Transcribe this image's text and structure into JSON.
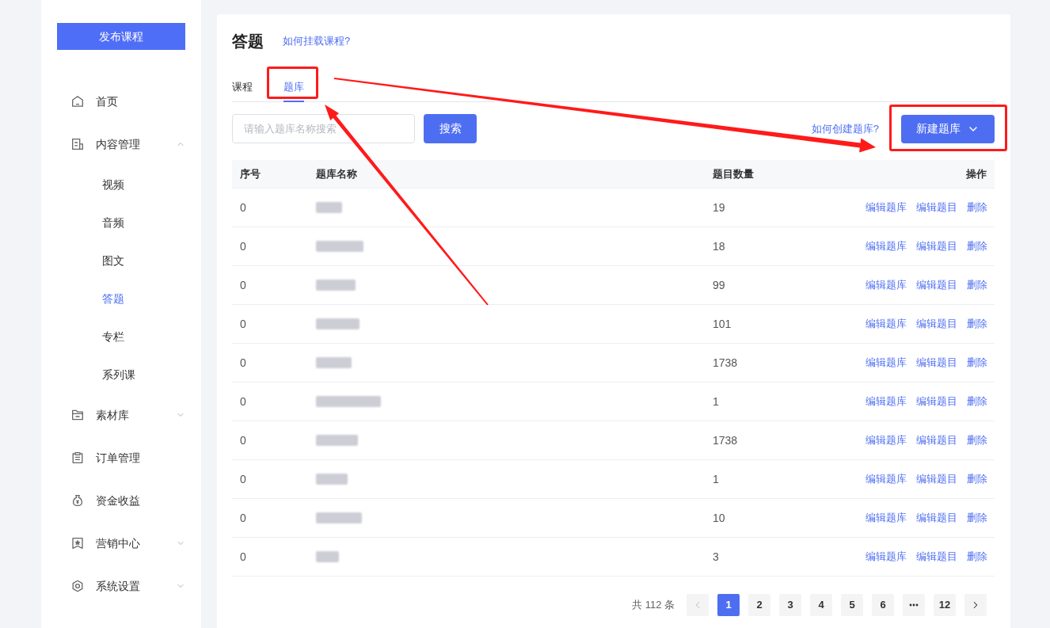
{
  "sidebar": {
    "publish_button": "发布课程",
    "items": [
      {
        "kind": "link",
        "label": "首页",
        "selected": false
      },
      {
        "kind": "group",
        "label": "内容管理",
        "selected": false,
        "expanded": true,
        "children": [
          {
            "label": "视频",
            "selected": false
          },
          {
            "label": "音频",
            "selected": false
          },
          {
            "label": "图文",
            "selected": false
          },
          {
            "label": "答题",
            "selected": true
          },
          {
            "label": "专栏",
            "selected": false
          },
          {
            "label": "系列课",
            "selected": false
          }
        ]
      },
      {
        "kind": "group",
        "label": "素材库",
        "selected": false,
        "expanded": false
      },
      {
        "kind": "link",
        "label": "订单管理",
        "selected": false
      },
      {
        "kind": "link",
        "label": "资金收益",
        "selected": false
      },
      {
        "kind": "group",
        "label": "营销中心",
        "selected": false,
        "expanded": false
      },
      {
        "kind": "group",
        "label": "系统设置",
        "selected": false,
        "expanded": false
      }
    ]
  },
  "header": {
    "title": "答题",
    "help_link": "如何挂载课程?"
  },
  "tabs": [
    {
      "label": "课程",
      "selected": false,
      "highlighted": false
    },
    {
      "label": "题库",
      "selected": true,
      "highlighted": true
    }
  ],
  "toolbar": {
    "search_placeholder": "请输入题库名称搜索",
    "search_button": "搜索",
    "help_link": "如何创建题库?",
    "create_button": {
      "label": "新建题库",
      "highlighted": true
    }
  },
  "table": {
    "columns": [
      "序号",
      "题库名称",
      "题目数量",
      "操作"
    ],
    "rows": [
      {
        "index": "0",
        "count": "19",
        "actions": [
          "编辑题库",
          "编辑题目",
          "删除"
        ]
      },
      {
        "index": "0",
        "count": "18",
        "actions": [
          "编辑题库",
          "编辑题目",
          "删除"
        ]
      },
      {
        "index": "0",
        "count": "99",
        "actions": [
          "编辑题库",
          "编辑题目",
          "删除"
        ]
      },
      {
        "index": "0",
        "count": "101",
        "actions": [
          "编辑题库",
          "编辑题目",
          "删除"
        ]
      },
      {
        "index": "0",
        "count": "1738",
        "actions": [
          "编辑题库",
          "编辑题目",
          "删除"
        ]
      },
      {
        "index": "0",
        "count": "1",
        "actions": [
          "编辑题库",
          "编辑题目",
          "删除"
        ]
      },
      {
        "index": "0",
        "count": "1738",
        "actions": [
          "编辑题库",
          "编辑题目",
          "删除"
        ]
      },
      {
        "index": "0",
        "count": "1",
        "actions": [
          "编辑题库",
          "编辑题目",
          "删除"
        ]
      },
      {
        "index": "0",
        "count": "10",
        "actions": [
          "编辑题库",
          "编辑题目",
          "删除"
        ]
      },
      {
        "index": "0",
        "count": "3",
        "actions": [
          "编辑题库",
          "编辑题目",
          "删除"
        ]
      }
    ]
  },
  "pagination": {
    "total": "共 112 条",
    "prev_disabled": true,
    "next_disabled": false,
    "pages": [
      {
        "kind": "page",
        "label": "1",
        "selected": true
      },
      {
        "kind": "page",
        "label": "2",
        "selected": false
      },
      {
        "kind": "page",
        "label": "3",
        "selected": false
      },
      {
        "kind": "page",
        "label": "4",
        "selected": false
      },
      {
        "kind": "page",
        "label": "5",
        "selected": false
      },
      {
        "kind": "page",
        "label": "6",
        "selected": false
      },
      {
        "kind": "more",
        "selected": false
      },
      {
        "kind": "page",
        "label": "12",
        "selected": false
      }
    ]
  }
}
